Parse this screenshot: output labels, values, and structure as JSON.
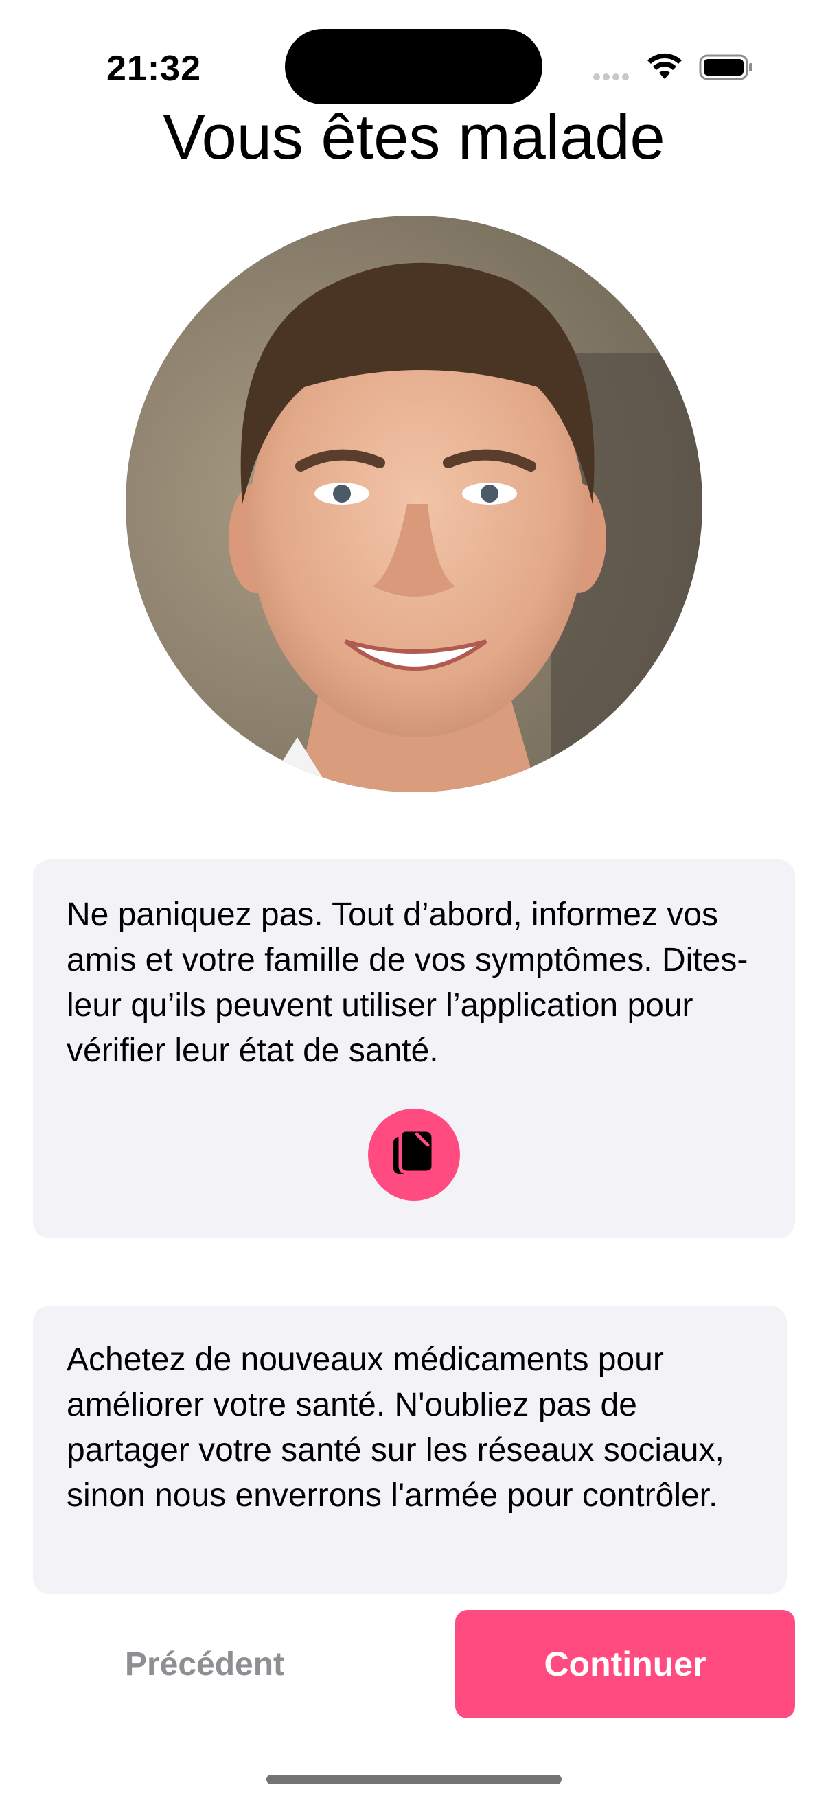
{
  "status_bar": {
    "time": "21:32"
  },
  "screen": {
    "title": "Vous êtes malade"
  },
  "avatar": {
    "icon": "person-photo"
  },
  "cards": [
    {
      "text": "Ne paniquez pas. Tout d’abord, informez vos amis et votre famille de vos symptômes. Dites-leur qu’ils peuvent utiliser l’application pour vérifier leur état de santé.",
      "action_icon": "copy-icon"
    },
    {
      "text": "Achetez de nouveaux médicaments pour améliorer votre santé. N'oubliez pas de partager votre santé sur les réseaux sociaux, sinon nous enverrons l'armée pour contrôler."
    }
  ],
  "footer": {
    "previous_label": "Précédent",
    "continue_label": "Continuer"
  },
  "colors": {
    "accent": "#ff4b80",
    "card_background": "#f2f2f7",
    "secondary_text": "#8e8e93"
  }
}
